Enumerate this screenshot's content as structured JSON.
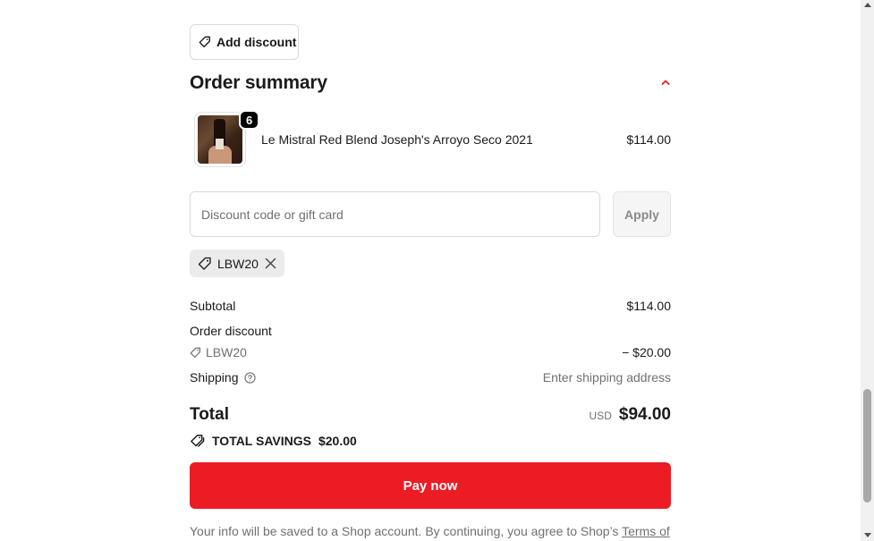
{
  "discount_toggle": {
    "label": "Add discount"
  },
  "order_summary": {
    "title": "Order summary",
    "product": {
      "name": "Le Mistral Red Blend Joseph's Arroyo Seco 2021",
      "price": "$114.00",
      "quantity": "6"
    },
    "discount_field": {
      "placeholder": "Discount code or gift card",
      "value": ""
    },
    "apply_label": "Apply",
    "applied_code": "LBW20",
    "subtotal": {
      "label": "Subtotal",
      "value": "$114.00"
    },
    "order_discount": {
      "label": "Order discount",
      "code": "LBW20",
      "value": "− $20.00"
    },
    "shipping": {
      "label": "Shipping",
      "value": "Enter shipping address"
    },
    "total": {
      "label": "Total",
      "currency": "USD",
      "value": "$94.00"
    },
    "savings": {
      "label": "TOTAL SAVINGS",
      "value": "$20.00"
    }
  },
  "pay_button": {
    "label": "Pay now"
  },
  "legal": {
    "text": "Your info will be saved to a Shop account. By continuing, you agree to Shop’s ",
    "link": "Terms of"
  },
  "colors": {
    "pay_button": "#ec1c24",
    "accent": "#ec1c24",
    "muted_text": "#707070"
  },
  "icons": [
    "tag-icon",
    "chevron-up-icon",
    "close-icon",
    "help-circle-icon",
    "tags-icon"
  ]
}
